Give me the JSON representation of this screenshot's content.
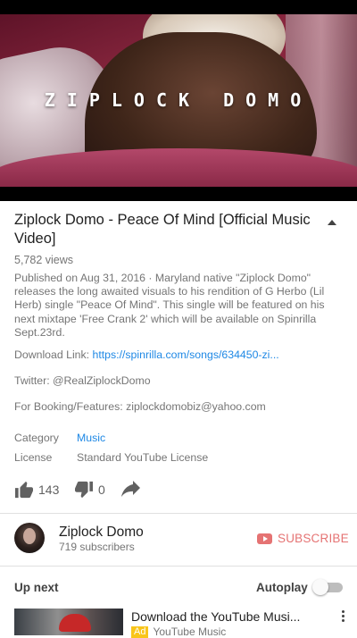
{
  "video": {
    "overlay_text": "ZIPLOCK DOMO"
  },
  "details": {
    "title": "Ziplock Domo - Peace Of Mind [Official Music Video]",
    "views": "5,782 views",
    "description": "Published on Aug 31, 2016 · Maryland native \"Ziplock Domo\" releases the long awaited visuals to his rendition of G Herbo (Lil Herb) single \"Peace Of Mind\". This single will be featured on his next mixtape 'Free Crank 2' which will be available on Spinrilla Sept.23rd.",
    "download_label": "Download Link: ",
    "download_url": "https://spinrilla.com/songs/634450-zi...",
    "twitter": "Twitter: @RealZiplockDomo",
    "booking": "For Booking/Features: ziplockdomobiz@yahoo.com",
    "category_label": "Category",
    "category_value": "Music",
    "license_label": "License",
    "license_value": "Standard YouTube License"
  },
  "actions": {
    "likes": "143",
    "dislikes": "0"
  },
  "channel": {
    "name": "Ziplock Domo",
    "subscribers": "719 subscribers",
    "subscribe_label": "SUBSCRIBE"
  },
  "up_next": {
    "label": "Up next",
    "autoplay_label": "Autoplay",
    "autoplay_on": false,
    "items": [
      {
        "title": "Download the YouTube Musi...",
        "ad_badge": "Ad",
        "channel": "YouTube Music"
      }
    ]
  },
  "colors": {
    "link": "#1e88e5",
    "subscribe": "#e57373",
    "ad_badge": "#f9c51a"
  }
}
